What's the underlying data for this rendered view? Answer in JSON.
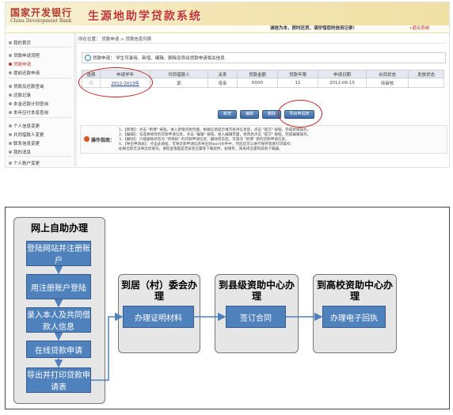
{
  "screenshot": {
    "bank_logo_cn": "国家开发银行",
    "bank_logo_en": "China Development Bank",
    "system_title": "生源地助学贷款系统",
    "slogan": "诚信为本，按时还贷，请珍惜您的信用记录！",
    "exit_label": "•退出系统",
    "nav": [
      {
        "label": "我的首页",
        "active": false
      },
      {
        "label": "贷款申请流程",
        "active": false
      },
      {
        "label": "贷款申请",
        "active": true
      },
      {
        "label": "提前还款申请",
        "active": false
      },
      {
        "label": "贷款及还款查询",
        "active": false
      },
      {
        "label": "还款记录",
        "active": false
      },
      {
        "label": "本金还款计划查询",
        "active": false
      },
      {
        "label": "本年应付本息查询",
        "active": false
      },
      {
        "label": "个人信息变更",
        "active": false
      },
      {
        "label": "共同借款人变更",
        "active": false
      },
      {
        "label": "联系信息变更",
        "active": false
      },
      {
        "label": "我的消息",
        "active": false
      },
      {
        "label": "个人账户变更",
        "active": false
      }
    ],
    "breadcrumb": "所在位置：  贷款申请 > 贷款信息列表",
    "info_text": "贷款申请：  学生可录用、新增、编辑、删除及导出贷款申请相关信息",
    "table": {
      "headers": [
        "选择",
        "申请学年",
        "共同借款人",
        "关系",
        "贷款金额",
        "贷款年限",
        "申请日期",
        "合同状态",
        "发放状态"
      ],
      "rows": [
        [
          "○",
          "2012-2013年",
          "郭",
          "母亲",
          "6000",
          "11",
          "2012-06-15",
          "待审核",
          ""
        ]
      ]
    },
    "buttons": [
      "新增",
      "编辑",
      "删除",
      "导出申请表"
    ],
    "tips_label": "操作指南：",
    "tips": [
      "1、【新增】：点击 \"新增\" 按钮，进入新增贷款页面，根据信息提示填写各项信息后，点击 \"提交\" 按钮，完成新增操作。",
      "2、【编辑】：勾选要修改的贷款申请信息，点击 \"编辑\" 按钮，进入编辑页面，修改后点击 \"提交\" 按钮，完成编辑操作。",
      "3、【删除】：只能删除状态为 \"待审核\" 的贷款申请信息；删除完毕后，可再次 \"新增\" 新的贷款申请信息。",
      "4、【导出申请表】：点击此按钮，可将贷款申请信息导出到word文件中，然后应可以进行保存或者打印操作；",
      "如果出现无法导出的情况，请检查电脑是否安装迅雷等下载软件，如果有，请关闭迅雷和其他下载器。"
    ]
  },
  "flowchart": {
    "panels": [
      {
        "title": "网上自助办理",
        "steps": [
          "登陆网站并注册账户",
          "用注册账户登陆",
          "录入本人及共同借款人信息",
          "在线贷款申请",
          "导出并打印贷款申请表"
        ]
      },
      {
        "title": "到居（村）委会办理",
        "steps": [
          "办理证明材料"
        ]
      },
      {
        "title": "到县级资助中心办理",
        "steps": [
          "签订合同"
        ]
      },
      {
        "title": "到高校资助中心办理",
        "steps": [
          "办理电子回执"
        ]
      }
    ],
    "colors": {
      "step_fill": "#4f81bd",
      "panel_fill": "#e6e6e6",
      "arrow": "#4f81bd"
    }
  }
}
